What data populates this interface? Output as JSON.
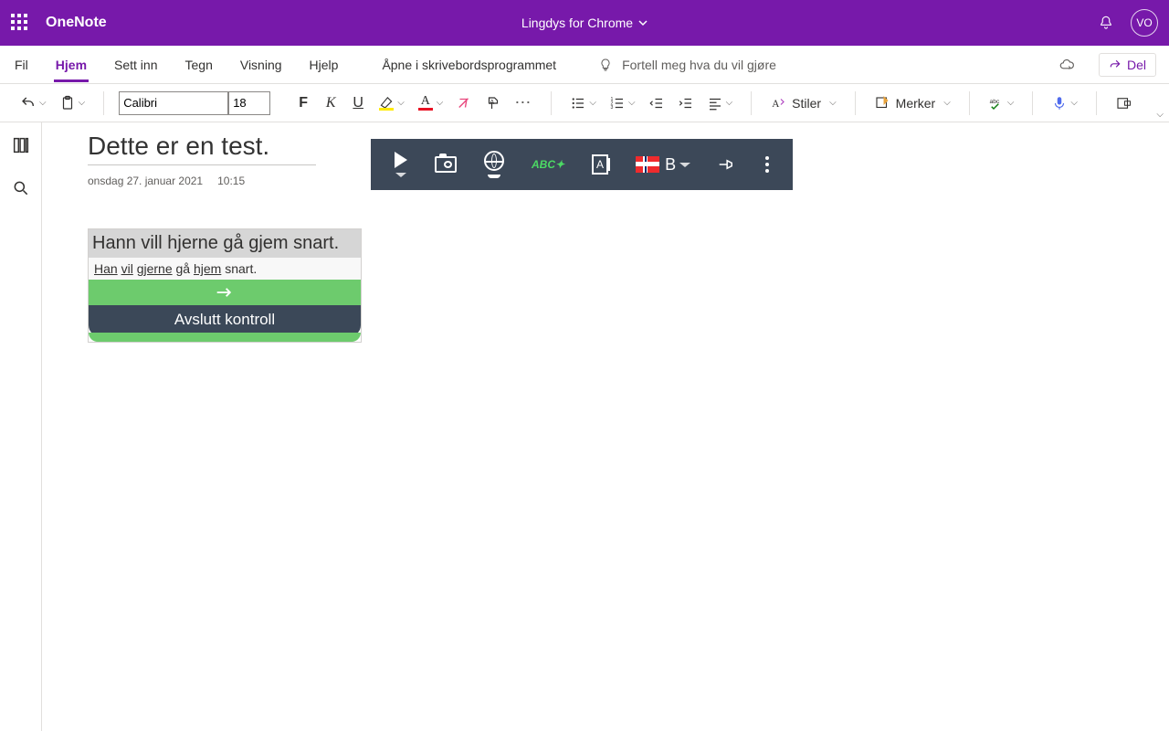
{
  "header": {
    "app_name": "OneNote",
    "doc_title": "Lingdys for Chrome",
    "avatar_initials": "VO"
  },
  "tabs": {
    "fil": "Fil",
    "hjem": "Hjem",
    "sett_inn": "Sett inn",
    "tegn": "Tegn",
    "visning": "Visning",
    "hjelp": "Hjelp",
    "open_desktop": "Åpne i skrivebordsprogrammet",
    "tellme_placeholder": "Fortell meg hva du vil gjøre",
    "share": "Del"
  },
  "toolbar": {
    "font_name": "Calibri",
    "font_size": "18",
    "stiler": "Stiler",
    "merker": "Merker"
  },
  "page": {
    "title": "Dette er en test.",
    "date": "onsdag 27. januar 2021",
    "time": "10:15"
  },
  "note": {
    "text": "Hann vill hjerne gå gjem snart.",
    "correction_words": [
      "Han",
      "vil",
      "gjerne",
      "gå",
      "hjem",
      "snart."
    ],
    "correction_underlined": [
      true,
      true,
      true,
      false,
      true,
      false
    ],
    "finish_label": "Avslutt kontroll"
  },
  "lingdys": {
    "abc_label": "ABC",
    "lang_label": "B"
  }
}
